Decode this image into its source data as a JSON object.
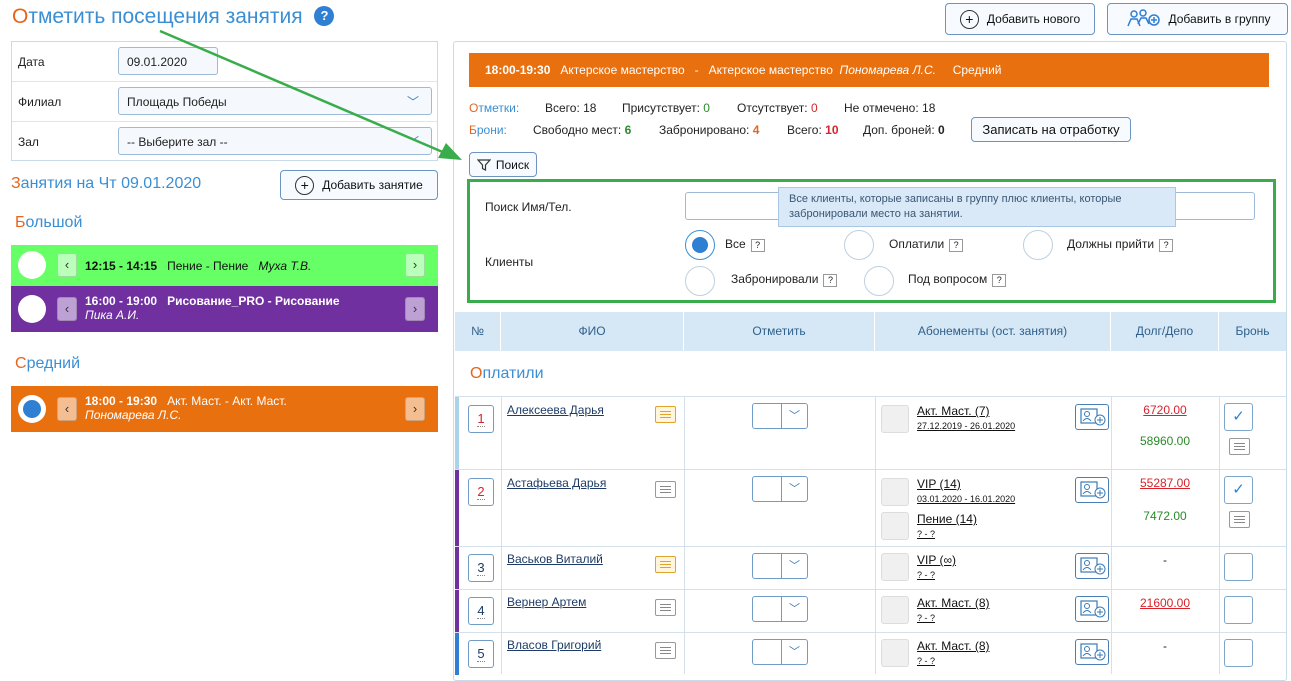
{
  "header": {
    "title_first": "О",
    "title_rest": "тметить посещения занятия",
    "help": "?",
    "add_new": "Добавить нового",
    "add_group": "Добавить в группу"
  },
  "filter": {
    "date_label": "Дата",
    "date_value": "09.01.2020",
    "branch_label": "Филиал",
    "branch_value": "Площадь Победы",
    "hall_label": "Зал",
    "hall_value": "-- Выберите зал --"
  },
  "lessons_header": {
    "title_first": "З",
    "title_rest": "анятия на Чт 09.01.2020",
    "add_lesson": "Добавить занятие"
  },
  "groups": [
    {
      "title_first": "Б",
      "title_rest": "ольшой",
      "lessons": [
        {
          "time": "12:15 - 14:15",
          "name": "Пение - Пение",
          "teacher": "Муха Т.В.",
          "color": "#66ff66"
        },
        {
          "time": "16:00 - 19:00",
          "name": "Рисование_PRO - Рисование",
          "teacher": "Пика А.И.",
          "color": "#7030a0"
        }
      ]
    },
    {
      "title_first": "С",
      "title_rest": "редний",
      "lessons": [
        {
          "time": "18:00 - 19:30",
          "name": "Акт. Маст. - Акт. Маст.",
          "teacher": "Пономарева Л.С.",
          "color": "#e8700f",
          "selected": true
        }
      ]
    }
  ],
  "banner": {
    "time": "18:00-19:30",
    "course": "Актерское мастерство",
    "dash": "-",
    "course2": "Актерское мастерство",
    "teacher": "Пономарева Л.С.",
    "level": "Средний"
  },
  "marks": {
    "label_first": "О",
    "label_rest": "тметки:",
    "total": "Всего: 18",
    "present_label": "Присутствует:",
    "present": "0",
    "absent_label": "Отсутствует:",
    "absent": "0",
    "unmarked_label": "Не отмечено:",
    "unmarked": "18"
  },
  "booking": {
    "label_first": "Б",
    "label_rest": "рони:",
    "free_label": "Свободно мест:",
    "free": "6",
    "booked_label": "Забронировано:",
    "booked": "4",
    "total_label": "Всего:",
    "total": "10",
    "extra_label": "Доп. броней:",
    "extra": "0",
    "makeup_button": "Записать на отработку"
  },
  "search": {
    "button": "Поиск",
    "name_label": "Поиск Имя/Тел.",
    "name_value": "",
    "clients_label": "Клиенты",
    "options": [
      {
        "label": "Все",
        "selected": true
      },
      {
        "label": "Оплатили",
        "selected": false
      },
      {
        "label": "Должны прийти",
        "selected": false
      },
      {
        "label": "Забронировали",
        "selected": false
      },
      {
        "label": "Под вопросом",
        "selected": false
      }
    ],
    "q": "?",
    "tooltip": "Все клиенты, которые записаны в группу плюс клиенты, которые забронировали место на занятии."
  },
  "table": {
    "headers": [
      "№",
      "ФИО",
      "Отметить",
      "Абонементы (ост. занятия)",
      "Долг/Депо",
      "Бронь"
    ],
    "group_first": "О",
    "group_rest": "платили",
    "rows": [
      {
        "num": "1",
        "name": "Алексеева Дарья",
        "sub": "Акт. Маст. (7)",
        "sub_dates": "27.12.2019 - 26.01.2020",
        "debt": "6720.00",
        "depo": "58960.00",
        "booked": true,
        "bar": "#a9d3e8"
      },
      {
        "num": "2",
        "name": "Астафьева Дарья",
        "sub": "VIP (14)",
        "sub_dates": "03.01.2020 - 16.01.2020",
        "sub2": "Пение (14)",
        "sub2_dates": "? - ?",
        "debt": "55287.00",
        "depo": "7472.00",
        "booked": true,
        "bar": "#7030a0"
      },
      {
        "num": "3",
        "name": "Васьков Виталий",
        "sub": "VIP (∞)",
        "sub_dates": "? - ?",
        "debt": "-",
        "booked": false,
        "bar": "#7030a0"
      },
      {
        "num": "4",
        "name": "Вернер Артем",
        "sub": "Акт. Маст. (8)",
        "sub_dates": "? - ?",
        "debt": "21600.00",
        "booked": false,
        "bar": "#7030a0"
      },
      {
        "num": "5",
        "name": "Власов Григорий",
        "sub": "Акт. Маст. (8)",
        "sub_dates": "? - ?",
        "debt": "-",
        "booked": false,
        "bar": "#2f7fd3"
      }
    ]
  },
  "colors": {
    "accent": "#3a8fd4",
    "orange": "#e8641b",
    "green_frame": "#3aac4c"
  }
}
